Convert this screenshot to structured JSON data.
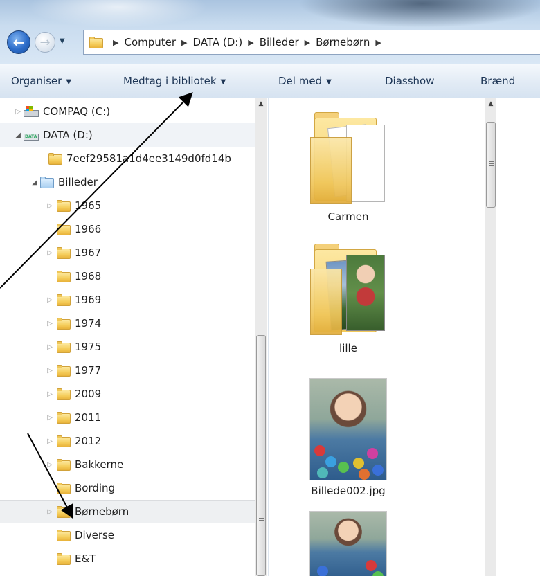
{
  "address": {
    "crumbs": [
      "Computer",
      "DATA (D:)",
      "Billeder",
      "Børnebørn"
    ]
  },
  "toolbar": {
    "organise": "Organiser",
    "include_library": "Medtag i bibliotek",
    "share": "Del med",
    "slideshow": "Diasshow",
    "burn": "Brænd"
  },
  "tree": {
    "drive_c": "COMPAQ (C:)",
    "drive_d": "DATA (D:)",
    "hash_folder": "7eef29581a1d4ee3149d0fd14b",
    "billeder": "Billeder",
    "folders": [
      "1965",
      "1966",
      "1967",
      "1968",
      "1969",
      "1974",
      "1975",
      "1977",
      "2009",
      "2011",
      "2012",
      "Bakkerne",
      "Bording",
      "Børnebørn",
      "Diverse",
      "E&T"
    ]
  },
  "content": {
    "items": [
      "Carmen",
      "lille",
      "Billede002.jpg"
    ]
  },
  "colors": {
    "accent": "#2c6cc9",
    "folder": "#f2c95a",
    "selection": "#eef0f2"
  },
  "icons": {
    "back": "back-arrow-icon",
    "forward": "forward-arrow-icon",
    "folder": "folder-icon",
    "drive": "drive-icon"
  }
}
